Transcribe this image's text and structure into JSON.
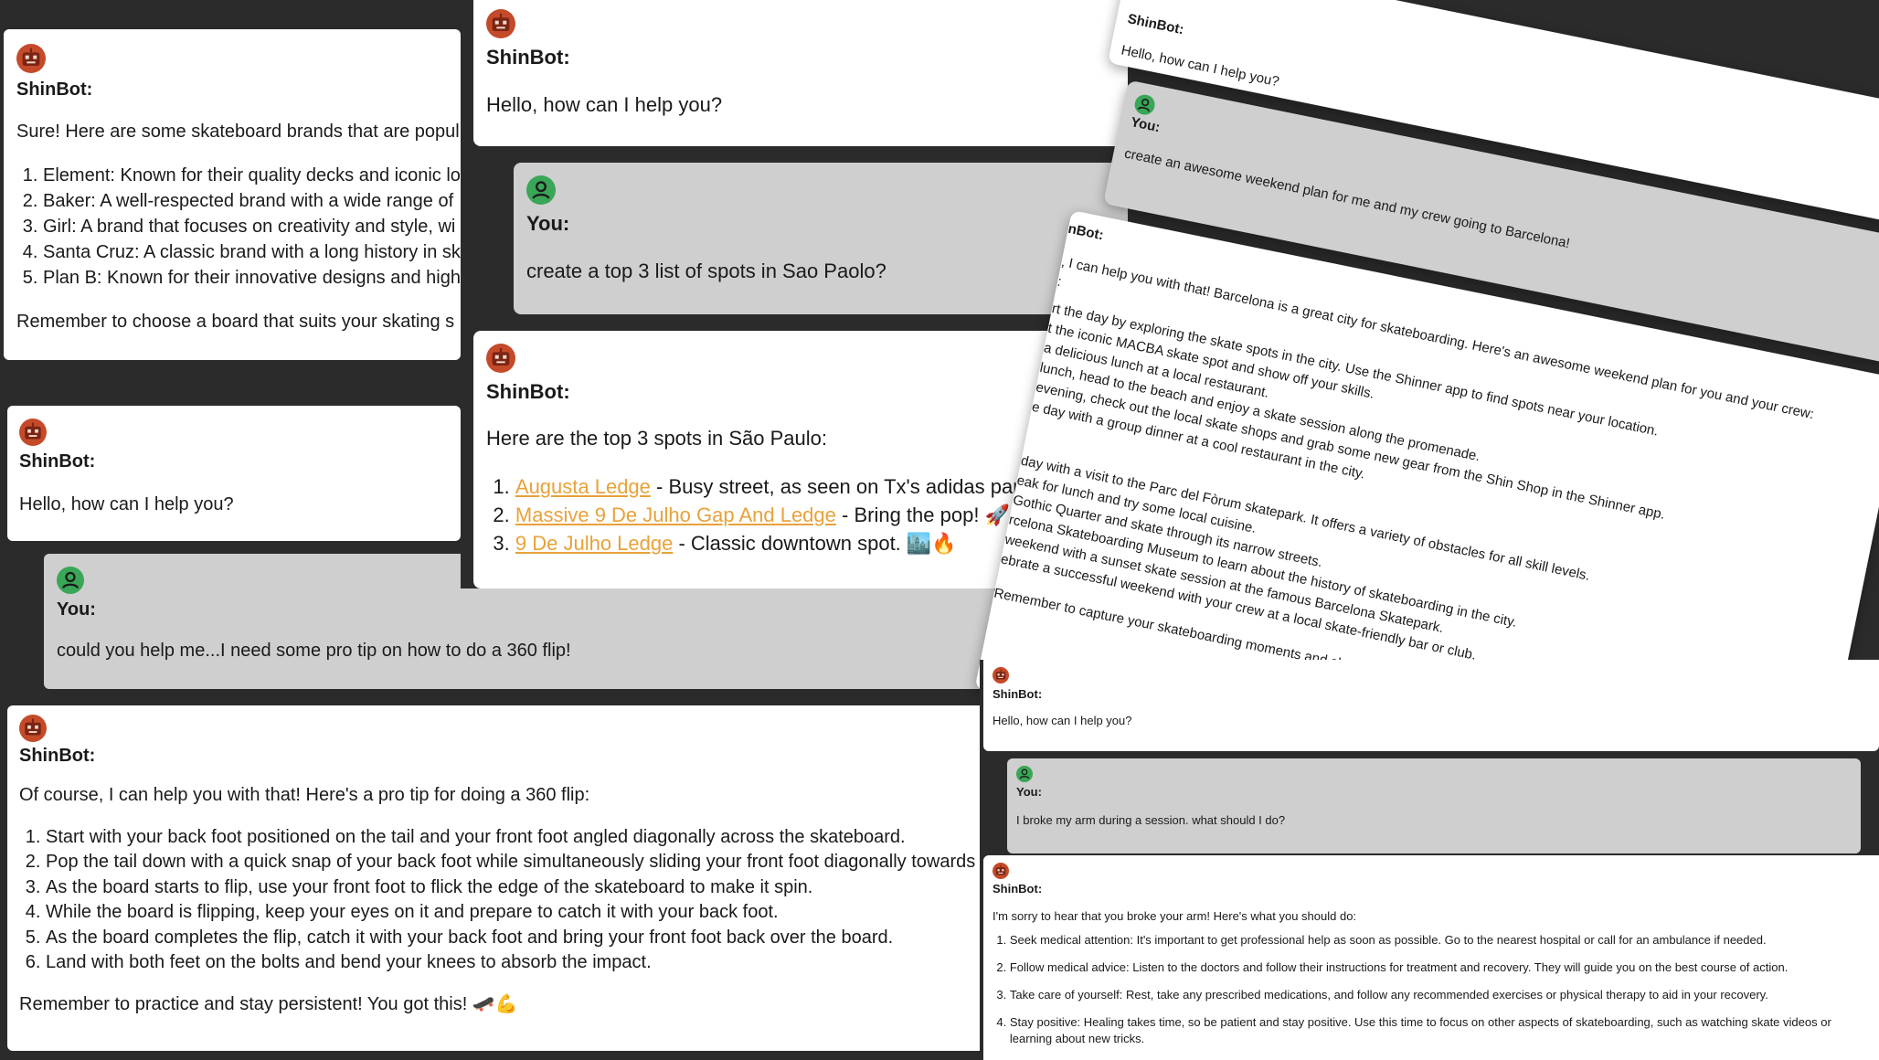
{
  "bot_name": "ShinBot:",
  "user_name": "You:",
  "greeting": "Hello, how can I help you?",
  "colors": {
    "background": "#2b2b2b",
    "bot_bubble": "#ffffff",
    "user_bubble": "#cfcfcf",
    "link": "#e8a23a",
    "bot_avatar": "#c44a2a",
    "user_avatar": "#3aa657"
  },
  "brands": {
    "intro": "Sure! Here are some skateboard brands that are popul",
    "items": [
      "Element: Known for their quality decks and iconic lo",
      "Baker: A well-respected brand with a wide range of",
      "Girl: A brand that focuses on creativity and style, wi",
      "Santa Cruz: A classic brand with a long history in sk",
      "Plan B: Known for their innovative designs and high"
    ],
    "outro": "Remember to choose a board that suits your skating s"
  },
  "saopaulo": {
    "user_msg": "create a top 3 list of spots in Sao Paolo?",
    "intro": "Here are the top 3 spots in São Paulo:",
    "spots": [
      {
        "link": "Augusta Ledge",
        "rest": " - Busy street, as seen on Tx's adidas part. 🛹🔥"
      },
      {
        "link": "Massive 9 De Julho Gap And Ledge",
        "rest": " - Bring the pop! 🚀🔥"
      },
      {
        "link": "9 De Julho Ledge",
        "rest": " - Classic downtown spot. 🏙️🔥"
      }
    ]
  },
  "flip": {
    "user_msg": "could you help me...I need some pro tip on how to do a 360 flip!",
    "intro": "Of course, I can help you with that! Here's a pro tip for doing a 360 flip:",
    "steps": [
      "Start with your back foot positioned on the tail and your front foot angled diagonally across the skateboard.",
      "Pop the tail down with a quick snap of your back foot while simultaneously sliding your front foot diagonally towards",
      "As the board starts to flip, use your front foot to flick the edge of the skateboard to make it spin.",
      "While the board is flipping, keep your eyes on it and prepare to catch it with your back foot.",
      "As the board completes the flip, catch it with your back foot and bring your front foot back over the board.",
      "Land with both feet on the bolts and bend your knees to absorb the impact."
    ],
    "outro": "Remember to practice and stay persistent! You got this! 🛹💪"
  },
  "barcelona": {
    "user_msg": "create an awesome weekend plan for me and my crew going to Barcelona!",
    "bot_name_partial": "nBot:",
    "intro": ", I can help you with that! Barcelona is a great city for skateboarding. Here's an awesome weekend plan for you and your crew:",
    "colon_line": ":",
    "day1": [
      "rt the day by exploring the skate spots in the city. Use the Shinner app to find spots near your location.",
      "t the iconic MACBA skate spot and show off your skills.",
      "a delicious lunch at a local restaurant.",
      "lunch, head to the beach and enjoy a skate session along the promenade.",
      "evening, check out the local skate shops and grab some new gear from the Shin Shop in the Shinner app.",
      "e day with a group dinner at a cool restaurant in the city."
    ],
    "day2": [
      "day with a visit to the Parc del Fòrum skatepark. It offers a variety of obstacles for all skill levels.",
      "eak for lunch and try some local cuisine.",
      "Gothic Quarter and skate through its narrow streets.",
      "rcelona Skateboarding Museum to learn about the history of skateboarding in the city.",
      "weekend with a sunset skate session at the famous Barcelona Skatepark.",
      "ebrate a successful weekend with your crew at a local skate-friendly bar or club."
    ],
    "outro": "Remember to capture your skateboarding moments and share them with the Shinner community! Have a rad weekend in Barcelona! 🛹🌴😊"
  },
  "arm": {
    "user_msg": "I broke my arm during a session. what should I do?",
    "intro": "I'm sorry to hear that you broke your arm! Here's what you should do:",
    "steps": [
      "Seek medical attention: It's important to get professional help as soon as possible. Go to the nearest hospital or call for an ambulance if needed.",
      "Follow medical advice: Listen to the doctors and follow their instructions for treatment and recovery. They will guide you on the best course of action.",
      "Take care of yourself: Rest, take any prescribed medications, and follow any recommended exercises or physical therapy to aid in your recovery.",
      "Stay positive: Healing takes time, so be patient and stay positive. Use this time to focus on other aspects of skateboarding, such as watching skate videos or learning about new tricks."
    ]
  }
}
